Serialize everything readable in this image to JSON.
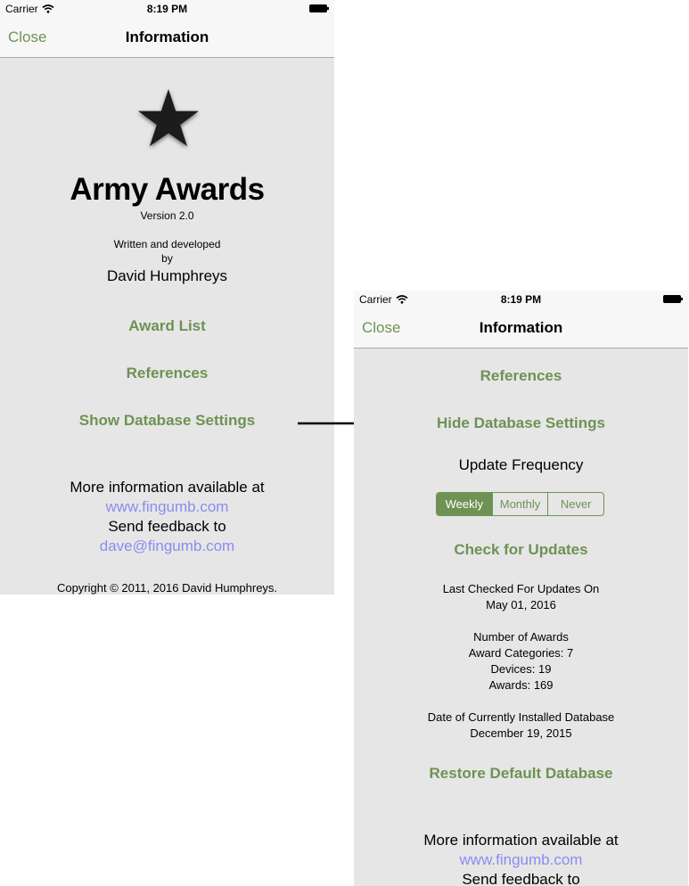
{
  "status": {
    "carrier": "Carrier",
    "time": "8:19 PM"
  },
  "nav": {
    "close": "Close",
    "title": "Information"
  },
  "left": {
    "app_name": "Army Awards",
    "version": "Version 2.0",
    "written": "Written and developed",
    "by": "by",
    "author": "David Humphreys",
    "award_list": "Award List",
    "references": "References",
    "show_db": "Show Database Settings",
    "more_info": "More information available at",
    "website": "www.fingumb.com",
    "feedback": "Send feedback to",
    "email": "dave@fingumb.com",
    "copyright": "Copyright © 2011, 2016 David Humphreys."
  },
  "right": {
    "references": "References",
    "hide_db": "Hide Database Settings",
    "update_frequency": "Update Frequency",
    "segments": [
      "Weekly",
      "Monthly",
      "Never"
    ],
    "selected_segment": "Weekly",
    "check_updates": "Check for Updates",
    "last_checked_label": "Last Checked For Updates On",
    "last_checked_date": "May 01, 2016",
    "num_awards_label": "Number of Awards",
    "award_categories": "Award Categories: 7",
    "devices": "Devices: 19",
    "awards": "Awards: 169",
    "db_date_label": "Date of Currently Installed Database",
    "db_date": "December 19, 2015",
    "restore": "Restore Default Database",
    "more_info": "More information available at",
    "website": "www.fingumb.com",
    "feedback": "Send feedback to"
  },
  "colors": {
    "accent": "#6e9254",
    "link": "#8a8cf0",
    "background": "#e6e6e6",
    "bar": "#f7f7f7"
  }
}
